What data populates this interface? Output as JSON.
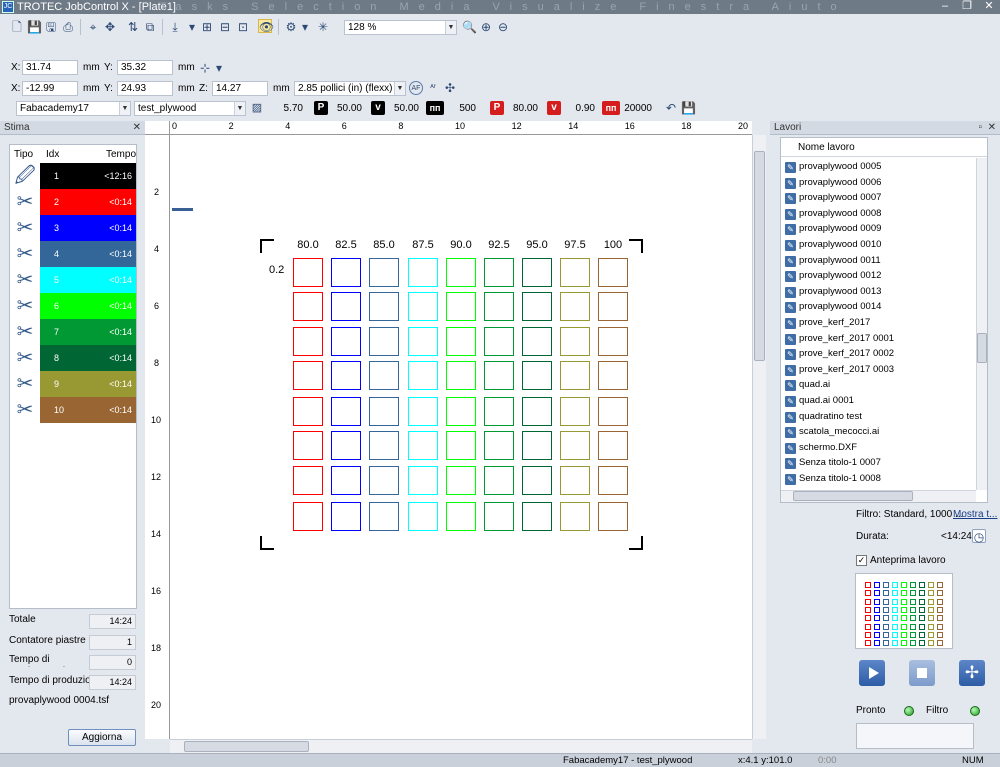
{
  "window": {
    "title": "TROTEC JobControl X - [Plate1]",
    "menu_ghost": "Tasks Selection Media Visualize Finestra Aiuto",
    "logo": "JC",
    "minimize": "–",
    "restore": "❐",
    "close": "✕"
  },
  "toolbar": {
    "zoom": "128 %"
  },
  "position": {
    "x_label": "X:",
    "x_value": "31.74",
    "x_unit": "mm",
    "y_label": "Y:",
    "y_value": "35.32",
    "y_unit": "mm"
  },
  "size": {
    "x_label": "X:",
    "x_value": "-12.99",
    "x_unit": "mm",
    "y_label": "Y:",
    "y_value": "24.93",
    "y_unit": "mm",
    "z_label": "Z:",
    "z_value": "14.27",
    "z_unit": "mm",
    "lens": "2.85 pollici (in) (flexx)"
  },
  "params": {
    "material_group": "Fabacademy17",
    "material": "test_plywood",
    "thickness": "5.70",
    "p1_icon": "P",
    "p1": "50.00",
    "v1_icon": "v",
    "v1": "50.00",
    "f1": "500",
    "p2_icon": "P",
    "p2": "80.00",
    "v2_icon": "v",
    "v2": "0.90",
    "f2": "20000"
  },
  "stima": {
    "title": "Stima",
    "close_glyph": "✕",
    "headers": {
      "tipo": "Tipo",
      "idx": "Idx",
      "tempo": "Tempo"
    },
    "rows": [
      {
        "idx": "1",
        "time": "<12:16",
        "color": "#000000",
        "tool": "engrave"
      },
      {
        "idx": "2",
        "time": "<0:14",
        "color": "#ff0000",
        "tool": "cut"
      },
      {
        "idx": "3",
        "time": "<0:14",
        "color": "#0000ff",
        "tool": "cut"
      },
      {
        "idx": "4",
        "time": "<0:14",
        "color": "#336699",
        "tool": "cut"
      },
      {
        "idx": "5",
        "time": "<0:14",
        "color": "#00ffff",
        "tool": "cut"
      },
      {
        "idx": "6",
        "time": "<0:14",
        "color": "#00ff00",
        "tool": "cut"
      },
      {
        "idx": "7",
        "time": "<0:14",
        "color": "#009933",
        "tool": "cut"
      },
      {
        "idx": "8",
        "time": "<0:14",
        "color": "#006633",
        "tool": "cut"
      },
      {
        "idx": "9",
        "time": "<0:14",
        "color": "#999933",
        "tool": "cut"
      },
      {
        "idx": "10",
        "time": "<0:14",
        "color": "#996633",
        "tool": "cut"
      }
    ],
    "totale_label": "Totale",
    "totale": "14:24",
    "contatore_label": "Contatore piastre",
    "contatore": "1",
    "movimentazione_label": "Tempo di movimentazione",
    "movimentazione": "0",
    "produzione_label": "Tempo di produzione",
    "produzione": "14:24",
    "file": "provaplywood 0004.tsf",
    "update_button": "Aggiorna"
  },
  "ruler": {
    "top": [
      "0",
      "2",
      "4",
      "6",
      "8",
      "10",
      "12",
      "14",
      "16",
      "18",
      "20"
    ],
    "left": [
      "2",
      "4",
      "6",
      "8",
      "10",
      "12",
      "14",
      "16",
      "18",
      "20"
    ]
  },
  "design": {
    "col_labels": [
      "80.0",
      "82.5",
      "85.0",
      "87.5",
      "90.0",
      "92.5",
      "95.0",
      "97.5",
      "100"
    ],
    "row_label": "0.2",
    "col_colors": [
      "#ff0000",
      "#0000ff",
      "#336699",
      "#00ffff",
      "#00ff00",
      "#009933",
      "#006633",
      "#999933",
      "#996633"
    ]
  },
  "lavori": {
    "title": "Lavori",
    "pin_glyph": "▫",
    "close_glyph": "✕",
    "header": "Nome lavoro",
    "items": [
      "provaplywood 0005",
      "provaplywood 0006",
      "provaplywood 0007",
      "provaplywood 0008",
      "provaplywood 0009",
      "provaplywood 0010",
      "provaplywood 0011",
      "provaplywood 0012",
      "provaplywood 0013",
      "provaplywood 0014",
      "prove_kerf_2017",
      "prove_kerf_2017 0001",
      "prove_kerf_2017 0002",
      "prove_kerf_2017 0003",
      "quad.ai",
      "quad.ai 0001",
      "quadratino test",
      "scatola_mecocci.ai",
      "schermo.DXF",
      "Senza titolo-1 0007",
      "Senza titolo-1 0008"
    ],
    "filter_text": "Filtro: Standard, 1000 ...",
    "show_all_link": "Mostra t...",
    "durata_label": "Durata:",
    "durata": "<14:24",
    "preview_label": "Anteprima lavoro",
    "pronto_label": "Pronto",
    "filtro_label": "Filtro"
  },
  "status": {
    "material": "Fabacademy17 - test_plywood",
    "coords": "x:4.1  y:101.0",
    "time": "0:00",
    "num": "NUM"
  }
}
